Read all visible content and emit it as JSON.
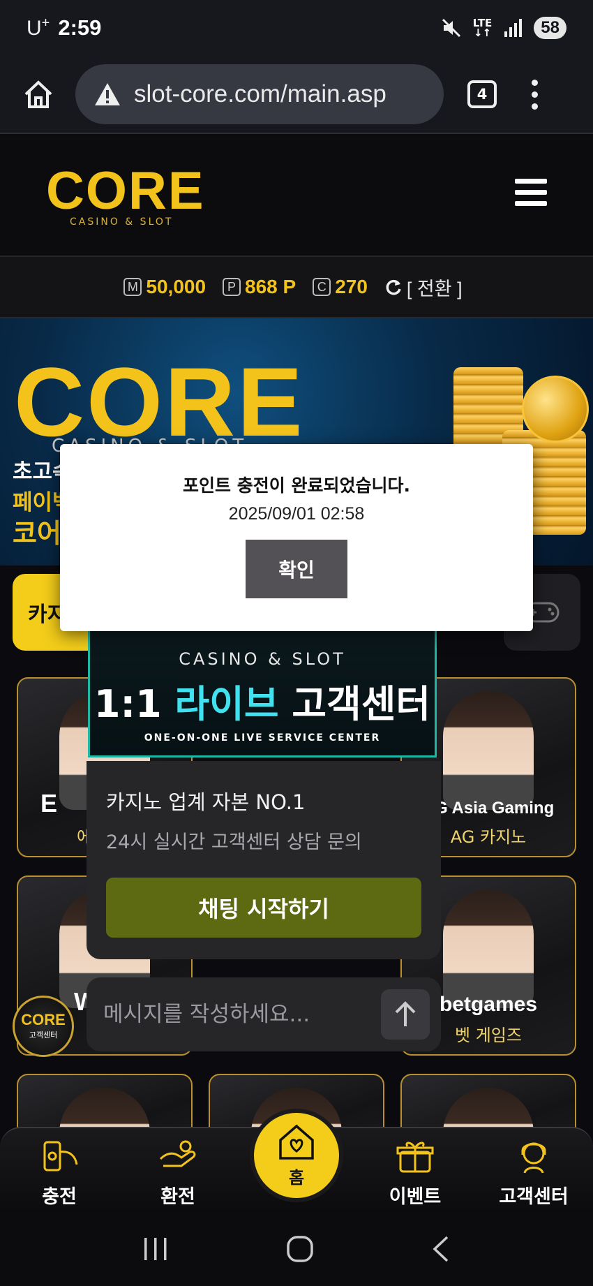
{
  "status_bar": {
    "carrier": "U",
    "carrier_sup": "+",
    "time": "2:59",
    "network": "LTE",
    "battery": "58"
  },
  "browser": {
    "url": "slot-core.com/main.asp",
    "tab_count": "4"
  },
  "site": {
    "logo_text": "CORE",
    "logo_subtitle": "CASINO & SLOT",
    "balances": [
      {
        "icon": "M",
        "value": "50,000"
      },
      {
        "icon": "P",
        "value": "868 P"
      },
      {
        "icon": "C",
        "value": "270"
      }
    ],
    "switch_label": "[ 전환 ]"
  },
  "banner": {
    "logo_text": "CORE",
    "logo_subtitle": "CASINO & SLOT",
    "line1": "초고속",
    "line2": "페이벡",
    "line3": "코어"
  },
  "category": {
    "active_label": "카지"
  },
  "games": [
    {
      "brand": "E",
      "label": "에"
    },
    {
      "brand": "AG Asia Gaming",
      "label": "AG 카지노"
    },
    {
      "brand": "W",
      "label": ""
    },
    {
      "brand": "betgames",
      "label": "벳 게임즈"
    }
  ],
  "chat": {
    "brand": "CASINO & SLOT",
    "title_prefix": "1:1",
    "title_highlight": "라이브",
    "title_suffix": "고객센터",
    "title_en": "ONE-ON-ONE LIVE SERVICE CENTER",
    "heading": "카지노 업계 자본 NO.1",
    "description": "24시 실시간 고객센터 상담 문의",
    "start_button": "채팅 시작하기",
    "input_placeholder": "메시지를 작성하세요..."
  },
  "float_logo": {
    "word": "CORE",
    "sub": "고객센터"
  },
  "dialog": {
    "message": "포인트 충전이 완료되었습니다.",
    "timestamp": "2025/09/01 02:58",
    "confirm": "확인"
  },
  "bottom_nav": {
    "items": [
      {
        "label": "충전",
        "icon": "deposit-icon"
      },
      {
        "label": "환전",
        "icon": "withdraw-icon"
      },
      {
        "label": "홈",
        "icon": "home-heart-icon"
      },
      {
        "label": "이벤트",
        "icon": "gift-icon"
      },
      {
        "label": "고객센터",
        "icon": "support-icon"
      }
    ]
  },
  "colors": {
    "accent": "#f3cd1a",
    "chat_button": "#5d6a11",
    "dialog_button": "#535155"
  }
}
